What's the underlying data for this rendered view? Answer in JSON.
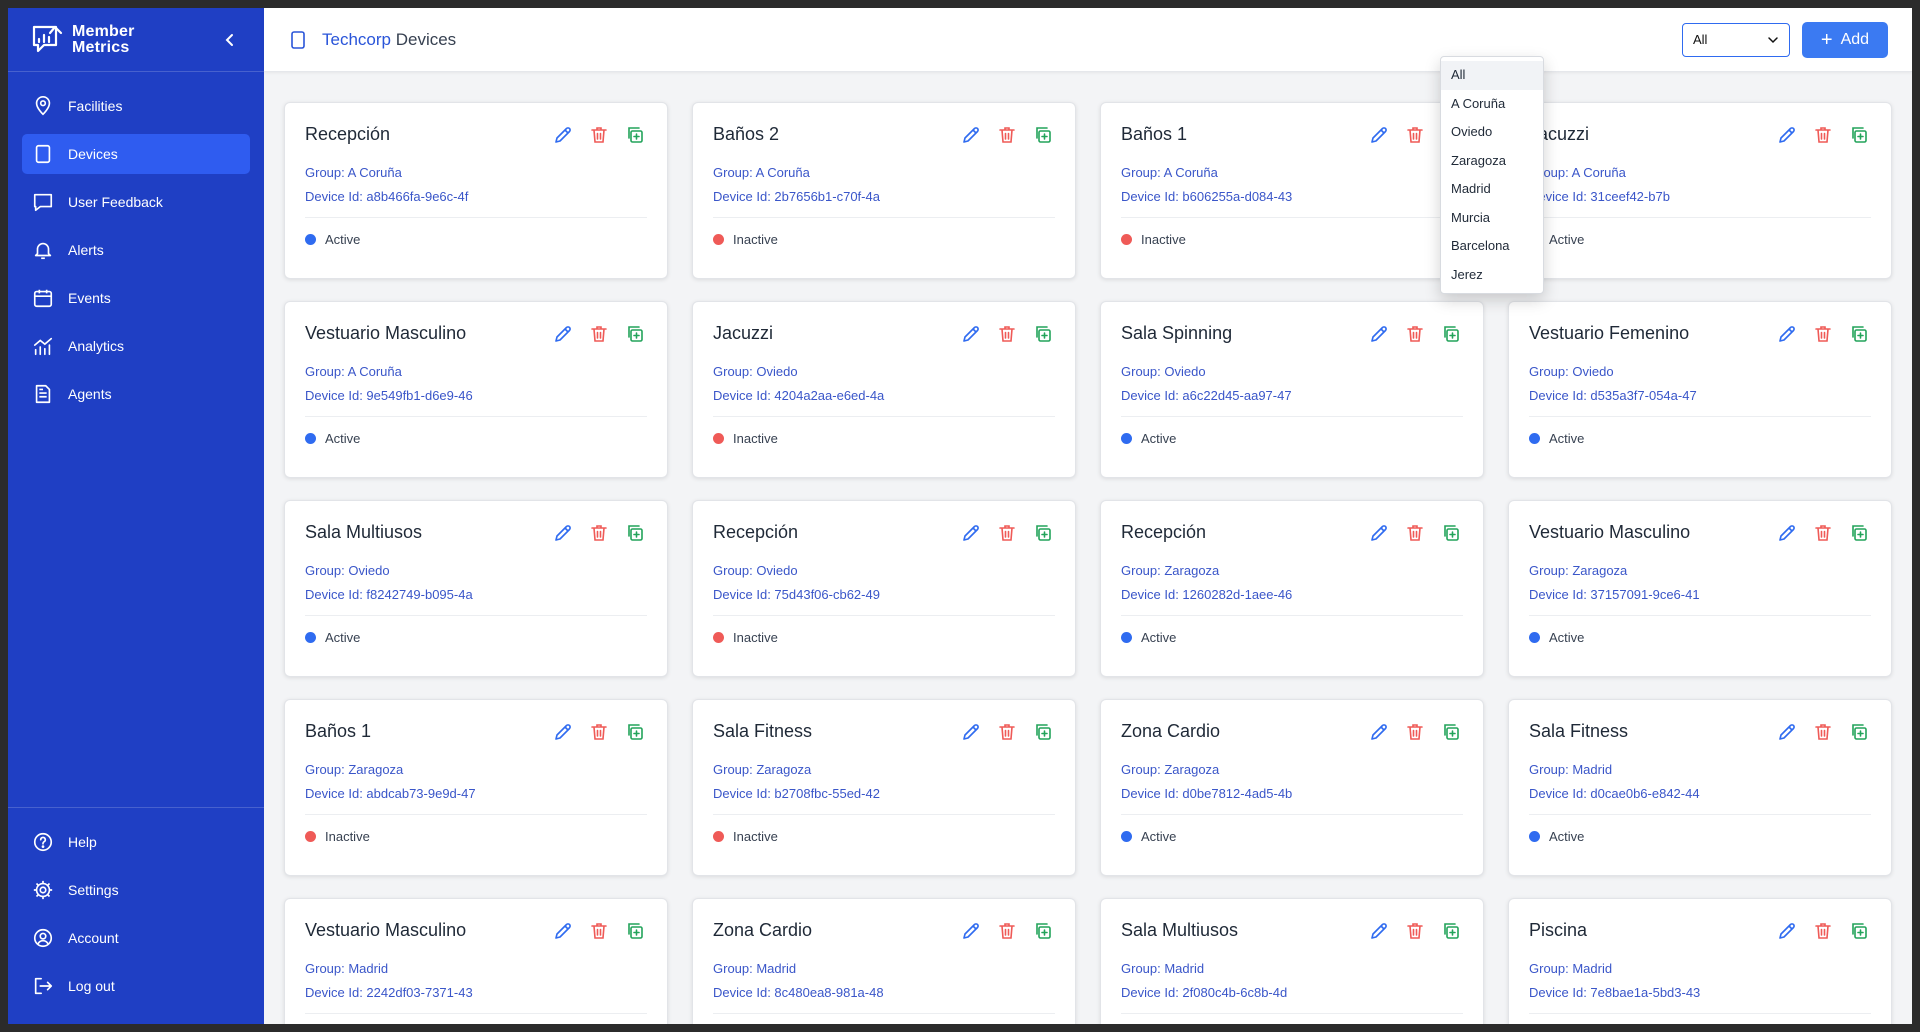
{
  "brand": {
    "line1": "Member",
    "line2": "Metrics"
  },
  "nav": {
    "items": [
      {
        "label": "Facilities",
        "icon": "map-pin-icon"
      },
      {
        "label": "Devices",
        "icon": "tablet-icon",
        "active": true
      },
      {
        "label": "User Feedback",
        "icon": "chat-icon"
      },
      {
        "label": "Alerts",
        "icon": "bell-icon"
      },
      {
        "label": "Events",
        "icon": "calendar-icon"
      },
      {
        "label": "Analytics",
        "icon": "analytics-icon"
      },
      {
        "label": "Agents",
        "icon": "document-icon"
      }
    ],
    "bottom": [
      {
        "label": "Help",
        "icon": "help-icon"
      },
      {
        "label": "Settings",
        "icon": "gear-icon"
      },
      {
        "label": "Account",
        "icon": "user-circle-icon"
      },
      {
        "label": "Log out",
        "icon": "logout-icon"
      }
    ]
  },
  "header": {
    "org": "Techcorp",
    "title": "Devices",
    "filter_value": "All",
    "add_label": "Add"
  },
  "dropdown": {
    "options": [
      "All",
      "A Coruña",
      "Oviedo",
      "Zaragoza",
      "Madrid",
      "Murcia",
      "Barcelona",
      "Jerez"
    ],
    "selected": "All"
  },
  "devices": [
    {
      "name": "Recepción",
      "group": "Group: A Coruña",
      "device_id": "Device Id: a8b466fa-9e6c-4f",
      "status": "Active"
    },
    {
      "name": "Baños 2",
      "group": "Group: A Coruña",
      "device_id": "Device Id: 2b7656b1-c70f-4a",
      "status": "Inactive"
    },
    {
      "name": "Baños 1",
      "group": "Group: A Coruña",
      "device_id": "Device Id: b606255a-d084-43",
      "status": "Inactive"
    },
    {
      "name": "Jacuzzi",
      "group": "Group: A Coruña",
      "device_id": "Device Id: 31ceef42-b7b",
      "status": "Active"
    },
    {
      "name": "Vestuario Masculino",
      "group": "Group: A Coruña",
      "device_id": "Device Id: 9e549fb1-d6e9-46",
      "status": "Active"
    },
    {
      "name": "Jacuzzi",
      "group": "Group: Oviedo",
      "device_id": "Device Id: 4204a2aa-e6ed-4a",
      "status": "Inactive"
    },
    {
      "name": "Sala Spinning",
      "group": "Group: Oviedo",
      "device_id": "Device Id: a6c22d45-aa97-47",
      "status": "Active"
    },
    {
      "name": "Vestuario Femenino",
      "group": "Group: Oviedo",
      "device_id": "Device Id: d535a3f7-054a-47",
      "status": "Active"
    },
    {
      "name": "Sala Multiusos",
      "group": "Group: Oviedo",
      "device_id": "Device Id: f8242749-b095-4a",
      "status": "Active"
    },
    {
      "name": "Recepción",
      "group": "Group: Oviedo",
      "device_id": "Device Id: 75d43f06-cb62-49",
      "status": "Inactive"
    },
    {
      "name": "Recepción",
      "group": "Group: Zaragoza",
      "device_id": "Device Id: 1260282d-1aee-46",
      "status": "Active"
    },
    {
      "name": "Vestuario Masculino",
      "group": "Group: Zaragoza",
      "device_id": "Device Id: 37157091-9ce6-41",
      "status": "Active"
    },
    {
      "name": "Baños 1",
      "group": "Group: Zaragoza",
      "device_id": "Device Id: abdcab73-9e9d-47",
      "status": "Inactive"
    },
    {
      "name": "Sala Fitness",
      "group": "Group: Zaragoza",
      "device_id": "Device Id: b2708fbc-55ed-42",
      "status": "Inactive"
    },
    {
      "name": "Zona Cardio",
      "group": "Group: Zaragoza",
      "device_id": "Device Id: d0be7812-4ad5-4b",
      "status": "Active"
    },
    {
      "name": "Sala Fitness",
      "group": "Group: Madrid",
      "device_id": "Device Id: d0cae0b6-e842-44",
      "status": "Active"
    },
    {
      "name": "Vestuario Masculino",
      "group": "Group: Madrid",
      "device_id": "Device Id: 2242df03-7371-43",
      "status": ""
    },
    {
      "name": "Zona Cardio",
      "group": "Group: Madrid",
      "device_id": "Device Id: 8c480ea8-981a-48",
      "status": ""
    },
    {
      "name": "Sala Multiusos",
      "group": "Group: Madrid",
      "device_id": "Device Id: 2f080c4b-6c8b-4d",
      "status": ""
    },
    {
      "name": "Piscina",
      "group": "Group: Madrid",
      "device_id": "Device Id: 7e8bae1a-5bd3-43",
      "status": ""
    }
  ],
  "colors": {
    "sidebar": "#1f3fc4",
    "active_nav": "#2f5cf0",
    "primary": "#3b7af2",
    "active_dot": "#2f6bf0",
    "inactive_dot": "#ef5a57",
    "edit_icon": "#2f6bf0",
    "delete_icon": "#ef5a57",
    "duplicate_icon": "#22a35a"
  }
}
